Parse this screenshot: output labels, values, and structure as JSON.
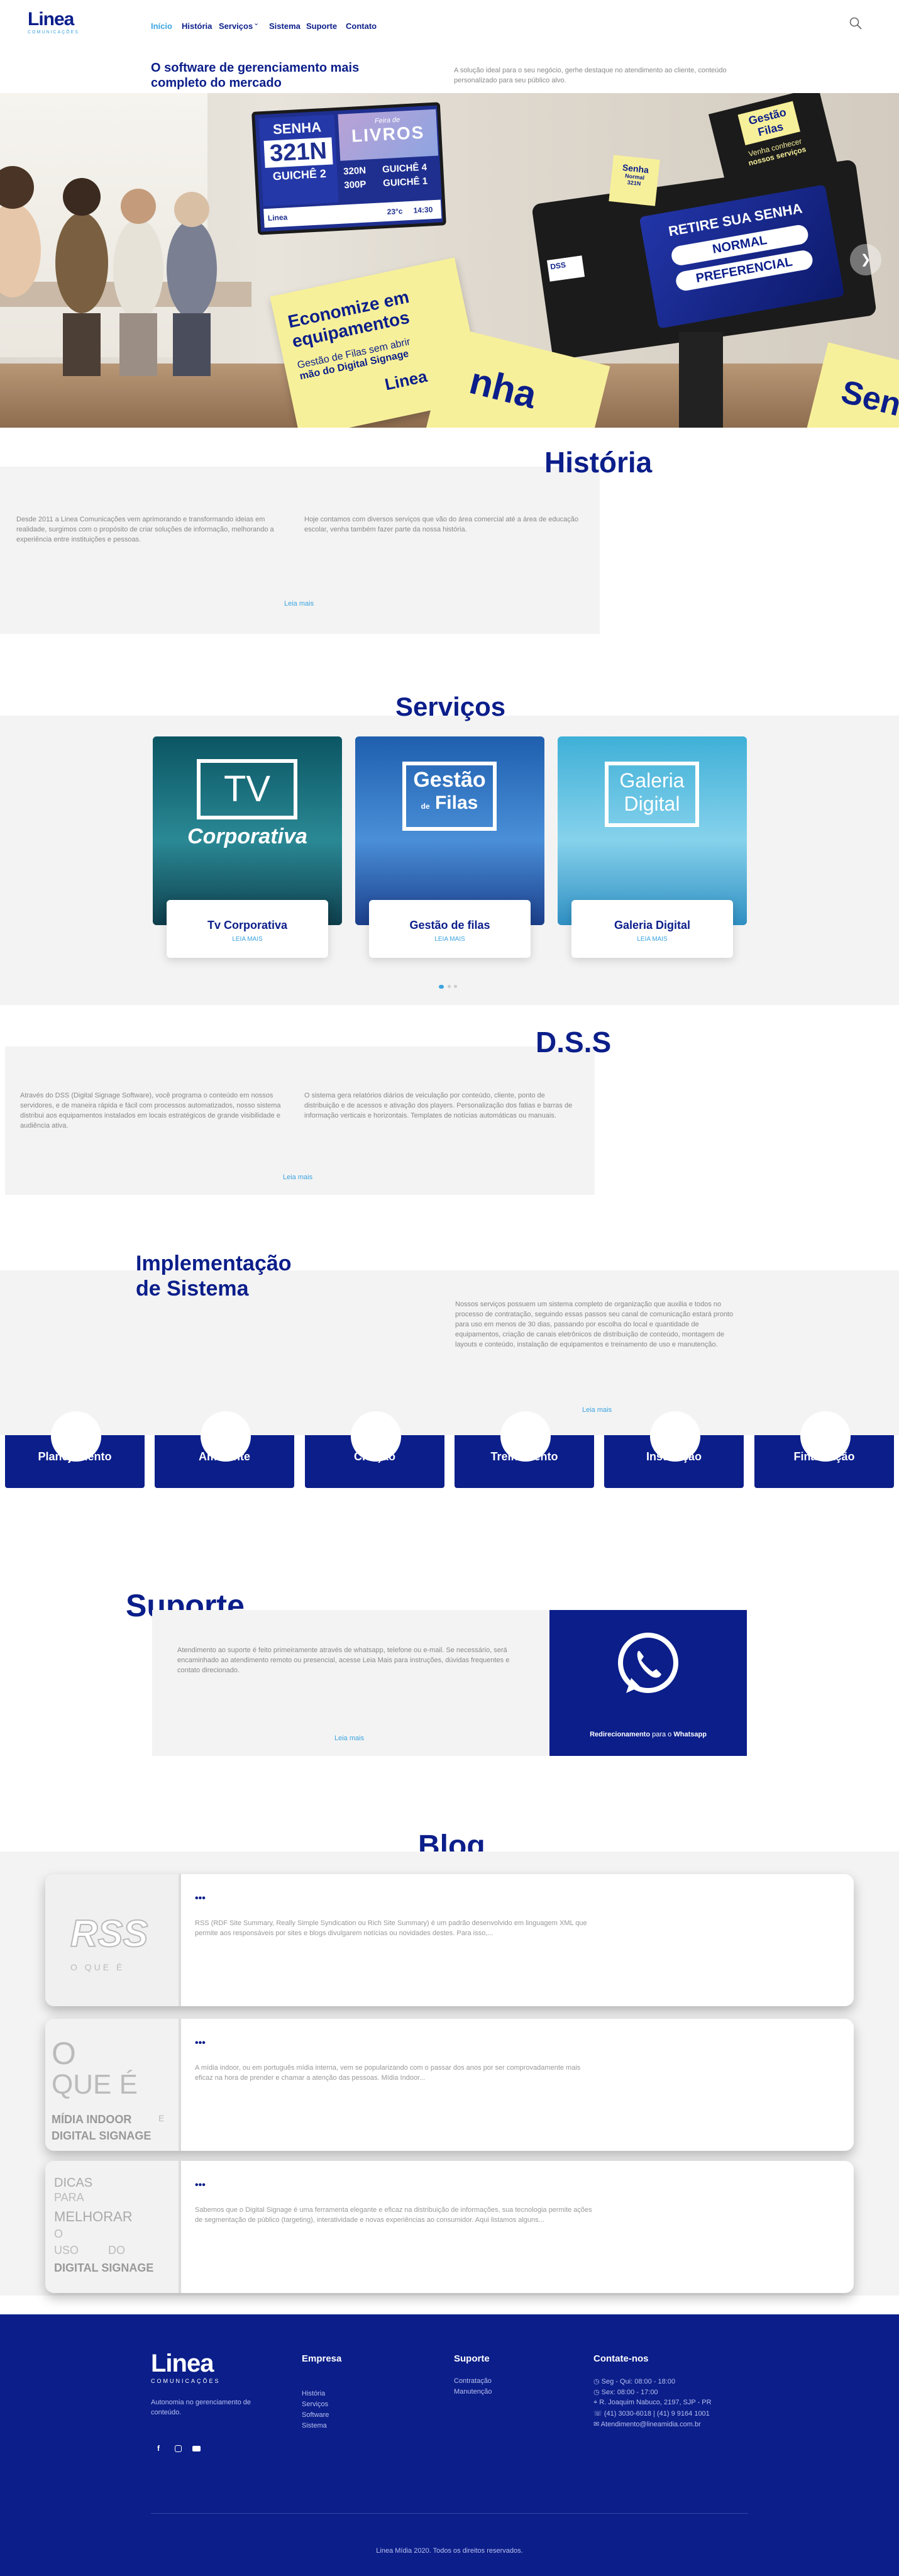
{
  "brand": {
    "logo_word": "Linea",
    "logo_sub": "COMUNICAÇÕES"
  },
  "nav": {
    "items": [
      "Início",
      "História",
      "Serviços",
      "Sistema",
      "Suporte",
      "Contato"
    ],
    "services_caret": "⌄",
    "search_icon": "search-icon"
  },
  "hero": {
    "title": "O software de gerenciamento mais completo do mercado",
    "description": "A solução ideal para o seu negócio, gerhe destaque no atendimento ao cliente, conteúdo personalizado para seu público alvo.",
    "screen": {
      "senha_label": "SENHA",
      "senha_number": "321N",
      "guiche_main": "GUICHÊ 2",
      "promo_small": "Feira de",
      "promo_big": "LIVROS",
      "row1_left": "320N",
      "row1_right": "GUICHÊ 4",
      "row2_left": "300P",
      "row2_right": "GUICHÊ 1",
      "temp": "23°c",
      "time": "14:30",
      "logo": "Linea"
    },
    "note_left": {
      "line1": "Economize em",
      "line2": "equipamentos",
      "line3": "Gestão de Filas sem abrir",
      "line4": "mão do Digital Signage",
      "logo": "Linea"
    },
    "kiosk": {
      "header": "RETIRE SUA SENHA",
      "btn1": "NORMAL",
      "btn2": "PREFERENCIAL",
      "badge": "DSS"
    },
    "sticky_senha": {
      "line1": "Senha",
      "line2": "Normal",
      "line3": "321N"
    },
    "sticky_gestao": {
      "line1": "Gestão",
      "line2": "Filas",
      "line3": "Venha conhecer",
      "line4": "nossos serviços"
    },
    "big_note": {
      "text1": "nha",
      "text2": "Senh"
    },
    "next_arrow": "❯"
  },
  "historia": {
    "title": "História",
    "col1": "Desde 2011 a Linea Comunicações vem aprimorando e transformando ideias em realidade, surgimos com o propósito de criar soluções de informação, melhorando a experiência entre instituições e pessoas.",
    "col2": "Hoje contamos com diversos serviços que vão do área comercial até a área de educação escolar, venha também fazer parte da nossa história.",
    "read_more": "Leia mais"
  },
  "servicos": {
    "title": "Serviços",
    "cards": [
      {
        "title": "Tv Corporativa",
        "link": "LEIA MAIS",
        "art1": "TV",
        "art2": "Corporativa"
      },
      {
        "title": "Gestão de filas",
        "link": "LEIA MAIS",
        "art1": "Gestão",
        "art2": "Filas",
        "art3": "de"
      },
      {
        "title": "Galeria Digital",
        "link": "LEIA MAIS",
        "art1": "Galeria",
        "art2": "Digital"
      }
    ]
  },
  "dss": {
    "title": "D.S.S",
    "col1": "Através do DSS (Digital Signage Software), você programa o conteúdo em nossos servidores, e de maneira rápida e fácil com processos automatizados, nosso sistema distribui aos equipamentos instalados em locais estratégicos de grande visibilidade e audiência ativa.",
    "col2": "O sistema gera relatórios diários de veiculação por conteúdo, cliente, ponto de distribuição e de acessos e ativação dos players. Personalização dos fatias e barras de informação verticais e horizontais. Templates de notícias automáticas ou manuais.",
    "read_more": "Leia mais"
  },
  "implementacao": {
    "title_line1": "Implementação",
    "title_line2": "de Sistema",
    "text": "Nossos serviços possuem um sistema completo de organização que auxilia e todos no processo de contratação, seguindo essas passos seu canal de comunicação estará pronto para uso em menos de 30 dias, passando por escolha do local e quantidade de equipamentos, criação de canais eletrônicos de distribuição de conteúdo, montagem de layouts e conteúdo, instalação de equipamentos e treinamento de uso e manutenção.",
    "read_more": "Leia mais",
    "steps": [
      "Planejamento",
      "Ambiente",
      "Criação",
      "Treinamento",
      "Instalação",
      "Finalização"
    ]
  },
  "suporte": {
    "title": "Suporte",
    "text": "Atendimento ao suporte é feito primeiramente através de whatsapp, telefone ou e-mail. Se necessário, será encaminhado ao atendimento remoto ou presencial, acesse Leia Mais para instruções, dúvidas frequentes e contato direcionado.",
    "read_more": "Leia mais",
    "whatsapp_bold": "Redirecionamento",
    "whatsapp_mid": " para o ",
    "whatsapp_end": "Whatsapp"
  },
  "blog": {
    "title": "Blog",
    "posts": [
      {
        "dots": "•••",
        "text": "RSS (RDF Site Summary, Really Simple Syndication ou Rich Site Summary) é um padrão desenvolvido em linguagem XML que permite aos responsáveis por sites e blogs divulgarem notícias ou novidades destes. Para isso,...",
        "thumb1": "RSS",
        "thumb2": "O QUE É"
      },
      {
        "dots": "•••",
        "text": "A mídia indoor, ou em português mídia interna, vem se popularizando com o passar dos anos por ser comprovadamente mais eficaz na hora de prender e chamar a atenção das pessoas. Mídia Indoor...",
        "thumb1": "O",
        "thumb2": "QUE É",
        "thumb3": "MÍDIA INDOOR",
        "thumb4": "E",
        "thumb5": "DIGITAL SIGNAGE"
      },
      {
        "dots": "•••",
        "text": "Sabemos que o Digital Signage é uma ferramenta elegante e eficaz na distribuição de informações, sua tecnologia permite ações de segmentação de público (targeting), interatividade e novas experiências ao consumidor. Aqui listamos alguns...",
        "thumb1": "DICAS",
        "thumb2": "PARA",
        "thumb3": "MELHORAR",
        "thumb4": "O",
        "thumb5": "USO",
        "thumb6": "DO",
        "thumb7": "DIGITAL SIGNAGE"
      }
    ]
  },
  "footer": {
    "tagline": "Autonomia no gerenciamento de conteúdo.",
    "empresa_title": "Empresa",
    "empresa_links": [
      "História",
      "Serviços",
      "Software",
      "Sistema"
    ],
    "suporte_title": "Suporte",
    "suporte_links": [
      "Contratação",
      "Manutenção"
    ],
    "contato_title": "Contate-nos",
    "contato_lines": [
      "Seg - Qui: 08:00 - 18:00",
      "Sex: 08:00 - 17:00",
      "R. Joaquim Nabuco, 2197, SJP - PR",
      "(41) 3030-6018 | (41) 9 9164 1001",
      "Atendimento@lineamidia.com.br"
    ],
    "copyright": "Linea Mídia 2020. Todos os direitos reservados.",
    "colors": {
      "footer_bg": "#0b1e8a",
      "accent": "#3aa3e0",
      "sticky_yellow": "#f7f09a"
    }
  }
}
